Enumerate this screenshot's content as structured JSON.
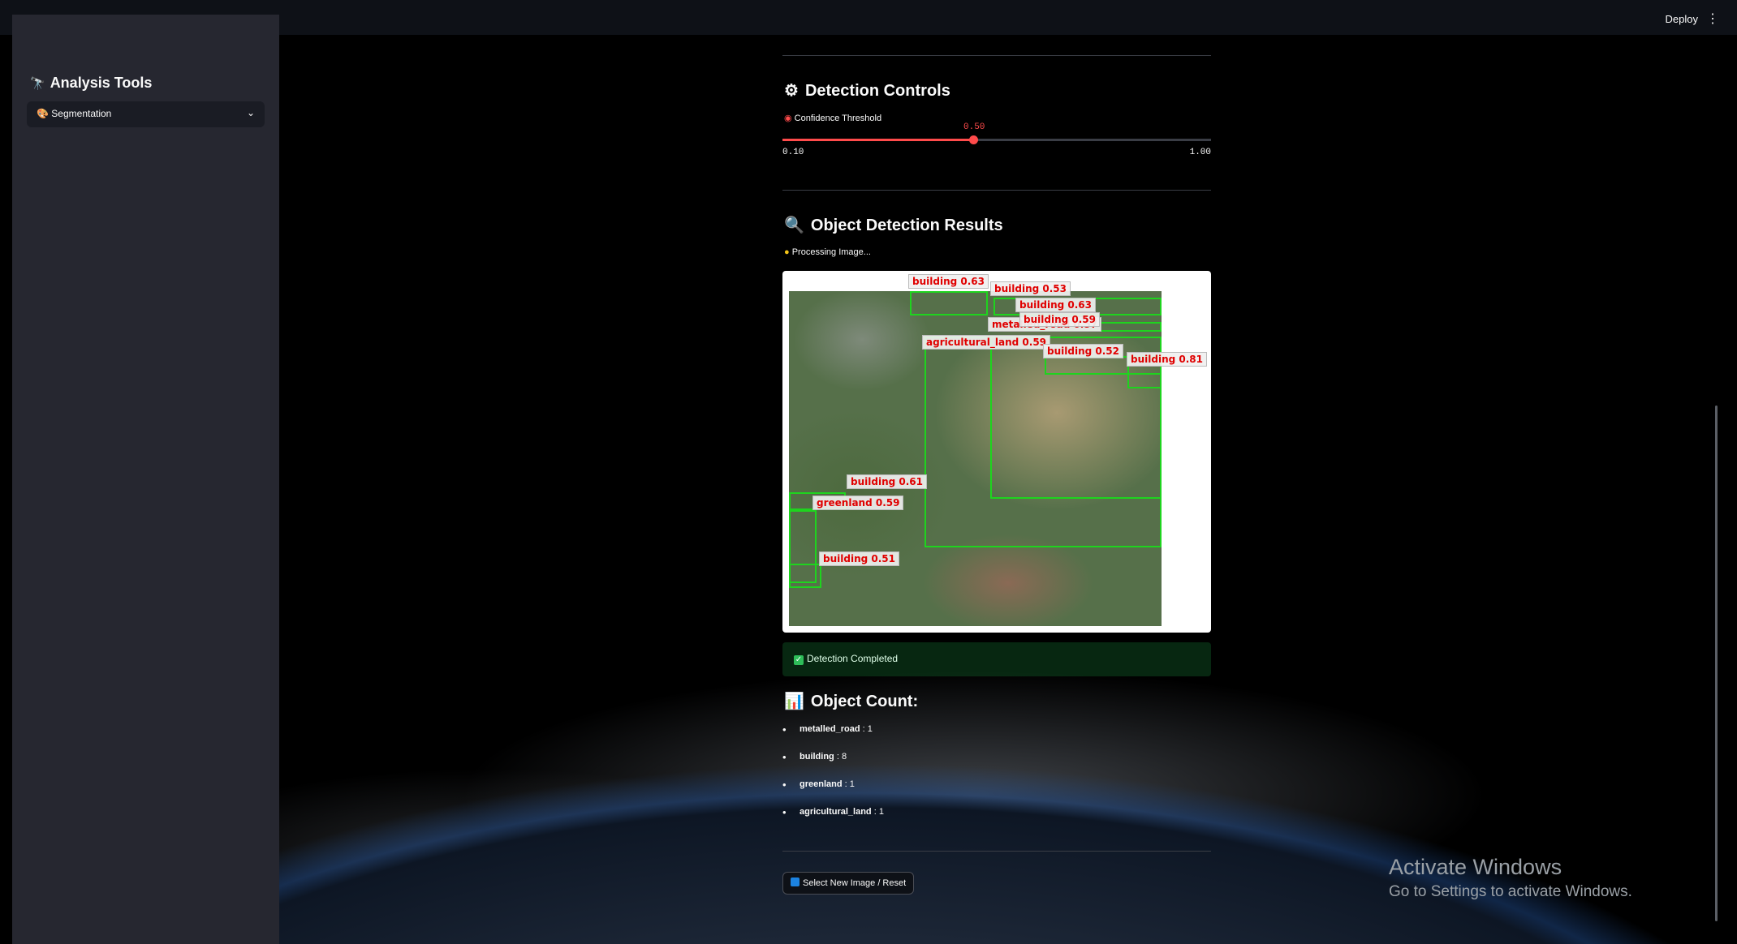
{
  "header": {
    "deploy_label": "Deploy",
    "menu_icon": "kebab-menu-icon"
  },
  "sidebar": {
    "title": "Analysis Tools",
    "title_icon": "telescope-icon",
    "select": {
      "icon": "segmentation-icon",
      "value": "Segmentation"
    }
  },
  "controls": {
    "title": "Detection Controls",
    "title_icon": "gear-icon",
    "threshold_label": "Confidence Threshold",
    "threshold_icon": "target-icon",
    "slider": {
      "value": 0.5,
      "value_text": "0.50",
      "min": 0.1,
      "max": 1.0,
      "min_text": "0.10",
      "max_text": "1.00"
    }
  },
  "results": {
    "title": "Object Detection Results",
    "title_icon": "magnifier-icon",
    "processing_text": "Processing Image...",
    "detections": [
      {
        "label": "building 0.63"
      },
      {
        "label": "building 0.53"
      },
      {
        "label": "building 0.63"
      },
      {
        "label": "building 0.59"
      },
      {
        "label": "metalled_road 0.57"
      },
      {
        "label": "agricultural_land 0.59"
      },
      {
        "label": "building 0.52"
      },
      {
        "label": "building 0.81"
      },
      {
        "label": "building 0.61"
      },
      {
        "label": "greenland 0.59"
      },
      {
        "label": "building 0.51"
      }
    ],
    "completed_text": "Detection Completed"
  },
  "object_count": {
    "title": "Object Count:",
    "title_icon": "bar-chart-icon",
    "items": [
      {
        "name": "metalled_road",
        "count": ": 1"
      },
      {
        "name": "building",
        "count": ": 8"
      },
      {
        "name": "greenland",
        "count": ": 1"
      },
      {
        "name": "agricultural_land",
        "count": ": 1"
      }
    ]
  },
  "reset_button": "Select New Image / Reset",
  "watermark": {
    "line1": "Activate Windows",
    "line2": "Go to Settings to activate Windows."
  },
  "colors": {
    "accent": "#ff4b4b",
    "bbox": "#1ed41e",
    "label_text": "#e00000",
    "success_bg": "#21c354"
  }
}
